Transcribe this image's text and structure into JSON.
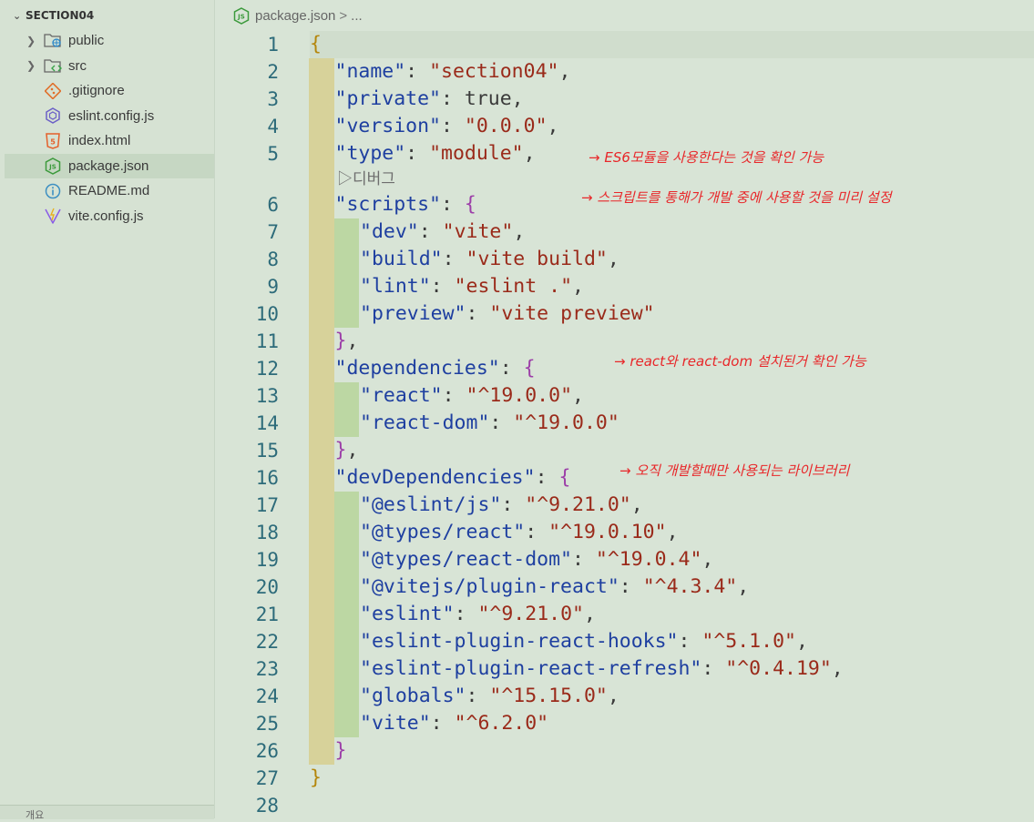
{
  "explorer": {
    "title": "SECTION04",
    "items": [
      {
        "label": "public",
        "type": "folder",
        "icon": "folder-public-icon"
      },
      {
        "label": "src",
        "type": "folder",
        "icon": "folder-src-icon"
      },
      {
        "label": ".gitignore",
        "type": "file",
        "icon": "git-icon"
      },
      {
        "label": "eslint.config.js",
        "type": "file",
        "icon": "eslint-icon"
      },
      {
        "label": "index.html",
        "type": "file",
        "icon": "html5-icon"
      },
      {
        "label": "package.json",
        "type": "file",
        "icon": "nodejs-icon",
        "selected": true
      },
      {
        "label": "README.md",
        "type": "file",
        "icon": "info-icon"
      },
      {
        "label": "vite.config.js",
        "type": "file",
        "icon": "vite-icon"
      }
    ],
    "bottom_label": "개요"
  },
  "breadcrumb": {
    "file": "package.json",
    "separator": ">",
    "more": "..."
  },
  "codelens": {
    "label": "디버그"
  },
  "code_lines": [
    {
      "n": "1",
      "text": "{"
    },
    {
      "n": "2",
      "text": "\"name\": \"section04\","
    },
    {
      "n": "3",
      "text": "\"private\": true,"
    },
    {
      "n": "4",
      "text": "\"version\": \"0.0.0\","
    },
    {
      "n": "5",
      "text": "\"type\": \"module\","
    },
    {
      "n": "6",
      "text": "\"scripts\": {"
    },
    {
      "n": "7",
      "text": "\"dev\": \"vite\","
    },
    {
      "n": "8",
      "text": "\"build\": \"vite build\","
    },
    {
      "n": "9",
      "text": "\"lint\": \"eslint .\","
    },
    {
      "n": "10",
      "text": "\"preview\": \"vite preview\""
    },
    {
      "n": "11",
      "text": "},"
    },
    {
      "n": "12",
      "text": "\"dependencies\": {"
    },
    {
      "n": "13",
      "text": "\"react\": \"^19.0.0\","
    },
    {
      "n": "14",
      "text": "\"react-dom\": \"^19.0.0\""
    },
    {
      "n": "15",
      "text": "},"
    },
    {
      "n": "16",
      "text": "\"devDependencies\": {"
    },
    {
      "n": "17",
      "text": "\"@eslint/js\": \"^9.21.0\","
    },
    {
      "n": "18",
      "text": "\"@types/react\": \"^19.0.10\","
    },
    {
      "n": "19",
      "text": "\"@types/react-dom\": \"^19.0.4\","
    },
    {
      "n": "20",
      "text": "\"@vitejs/plugin-react\": \"^4.3.4\","
    },
    {
      "n": "21",
      "text": "\"eslint\": \"^9.21.0\","
    },
    {
      "n": "22",
      "text": "\"eslint-plugin-react-hooks\": \"^5.1.0\","
    },
    {
      "n": "23",
      "text": "\"eslint-plugin-react-refresh\": \"^0.4.19\","
    },
    {
      "n": "24",
      "text": "\"globals\": \"^15.15.0\","
    },
    {
      "n": "25",
      "text": "\"vite\": \"^6.2.0\""
    },
    {
      "n": "26",
      "text": "}"
    },
    {
      "n": "27",
      "text": "}"
    },
    {
      "n": "28",
      "text": ""
    }
  ],
  "annotations": {
    "type_note": "→ ES6모듈을 사용한다는 것을 확인 가능",
    "scripts_note": "→ 스크립트를 통해가 개발 중에 사용할 것을 미리 설정",
    "deps_note": "→ react와 react-dom 설치된거 확인 가능",
    "devdeps_note": "→ 오직 개발할때만 사용되는 라이브러리"
  },
  "colors": {
    "key": "#1e3fa0",
    "string": "#9a2a1a",
    "brace_outer": "#b4860b",
    "brace_inner": "#9c3ea8",
    "line_number": "#2d6b7a",
    "annotation": "#e8272a"
  }
}
